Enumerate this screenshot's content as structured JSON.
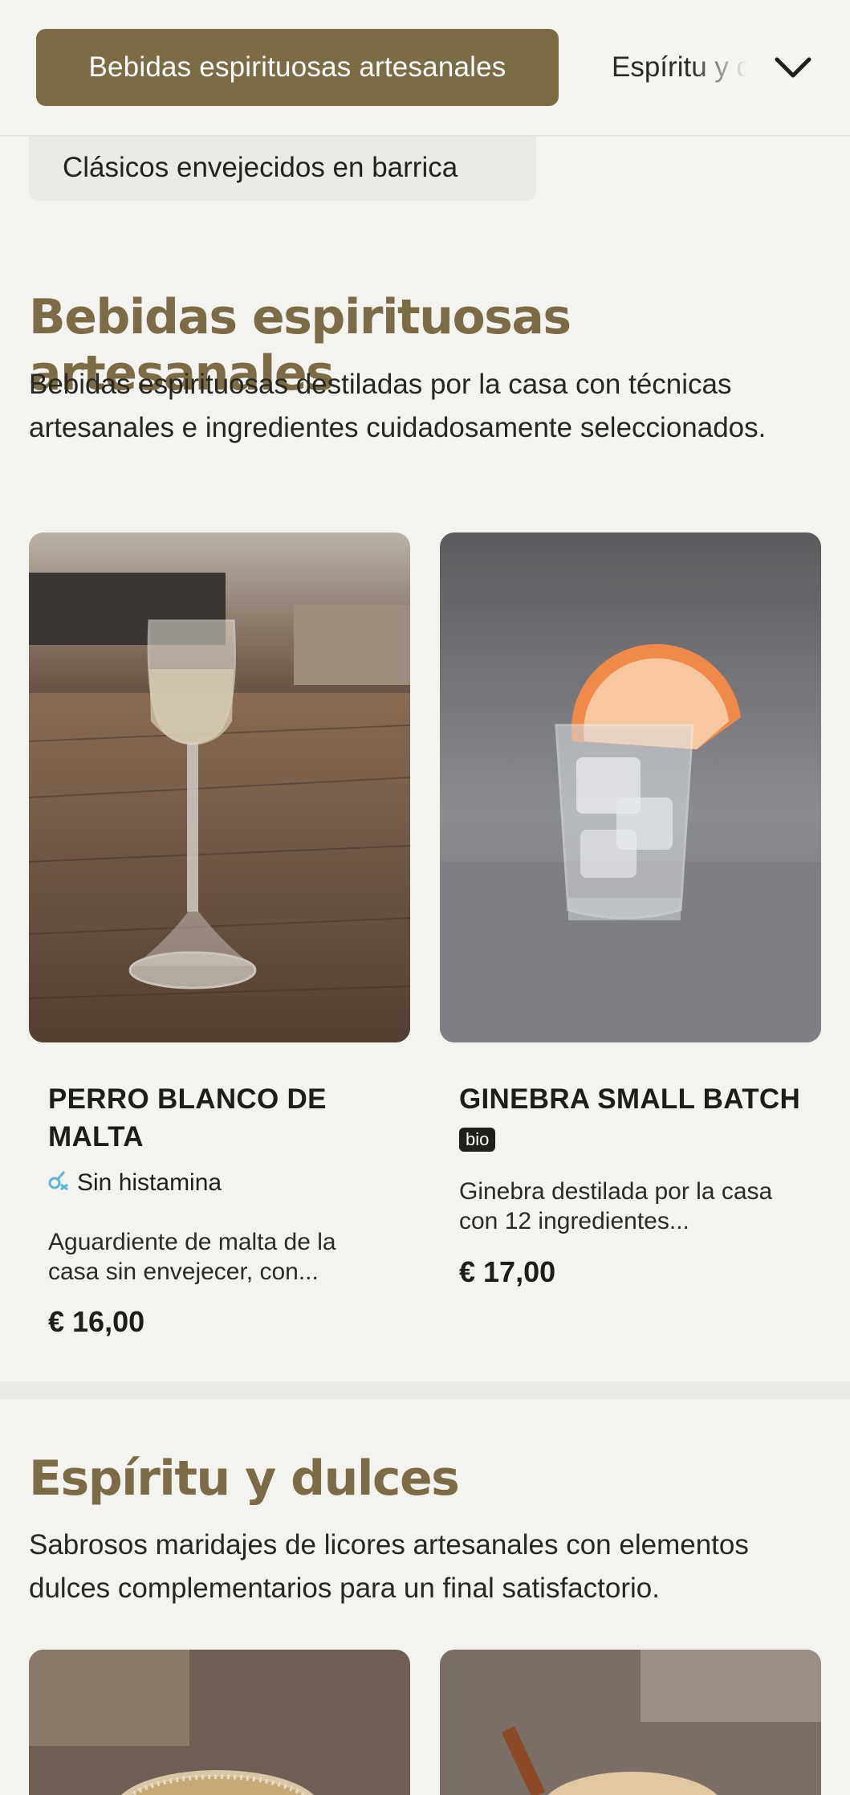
{
  "category_bar": {
    "active_label": "Bebidas espirituosas artesanales",
    "next_label": "Espíritu y dulces",
    "expand_icon": "chevron-down-icon"
  },
  "subcategory": {
    "label": "Clásicos envejecidos en barrica"
  },
  "sections": [
    {
      "title": "Bebidas espirituosas artesanales",
      "description": "Bebidas espirituosas destiladas por la casa con técnicas artesanales e ingredientes cuidadosamente seleccionados.",
      "products": [
        {
          "name": "PERRO BLANCO DE MALTA",
          "allergen_label": "Sin histamina",
          "allergen_icon": "histamine-free-icon",
          "description": "Aguardiente de malta de la casa sin envejecer, con...",
          "price": "€ 16,00"
        },
        {
          "name": "GINEBRA SMALL BATCH",
          "badge": "bio",
          "description": "Ginebra destilada por la casa con 12 ingredientes...",
          "price": "€ 17,00"
        }
      ]
    },
    {
      "title": "Espíritu y dulces",
      "description": "Sabrosos maridajes de licores artesanales con elementos dulces complementarios para un final satisfactorio."
    }
  ],
  "colors": {
    "accent": "#7c6c45",
    "background": "#f3f3ef",
    "allergen_icon": "#5ab8d6"
  }
}
